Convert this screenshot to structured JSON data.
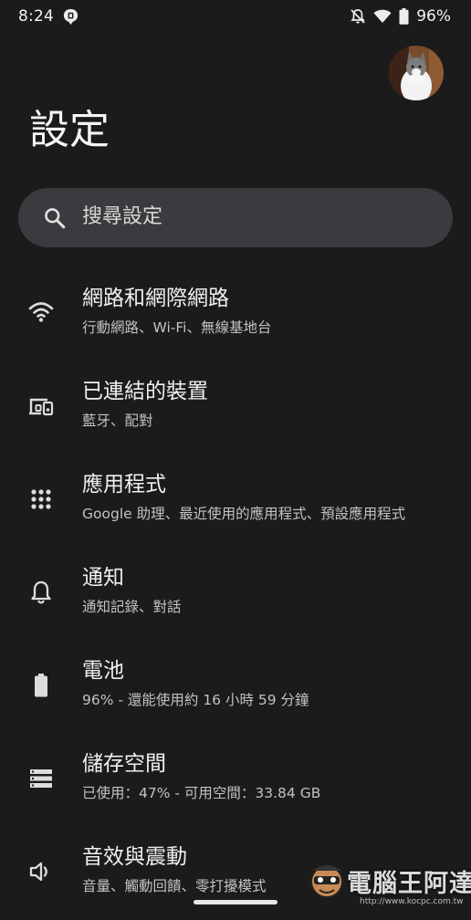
{
  "status_bar": {
    "time": "8:24",
    "battery_percent": "96%",
    "icons": [
      "notification-shield-icon",
      "mute-icon",
      "wifi-icon",
      "battery-icon"
    ]
  },
  "header": {
    "title": "設定",
    "avatar_icon": "user-avatar-cat"
  },
  "search": {
    "placeholder": "搜尋設定",
    "icon": "search-icon"
  },
  "settings": {
    "items": [
      {
        "title": "網路和網際網路",
        "subtitle": "行動網路、Wi-Fi、無線基地台",
        "icon": "wifi-icon"
      },
      {
        "title": "已連結的裝置",
        "subtitle": "藍牙、配對",
        "icon": "connected-devices-icon"
      },
      {
        "title": "應用程式",
        "subtitle": "Google 助理、最近使用的應用程式、預設應用程式",
        "icon": "apps-grid-icon"
      },
      {
        "title": "通知",
        "subtitle": "通知記錄、對話",
        "icon": "bell-icon"
      },
      {
        "title": "電池",
        "subtitle": "96% - 還能使用約 16 小時 59 分鐘",
        "icon": "battery-icon"
      },
      {
        "title": "儲存空間",
        "subtitle": "已使用：47% - 可用空間：33.84 GB",
        "icon": "storage-icon"
      },
      {
        "title": "音效與震動",
        "subtitle": "音量、觸動回饋、零打擾模式",
        "icon": "volume-icon"
      }
    ]
  },
  "watermark": {
    "text": "電腦王阿達",
    "url": "http://www.kocpc.com.tw"
  },
  "colors": {
    "background": "#1b1b1b",
    "search_bg": "#3a3b3e",
    "text_primary": "#f0f0f0",
    "text_secondary": "#c2c2c2"
  }
}
